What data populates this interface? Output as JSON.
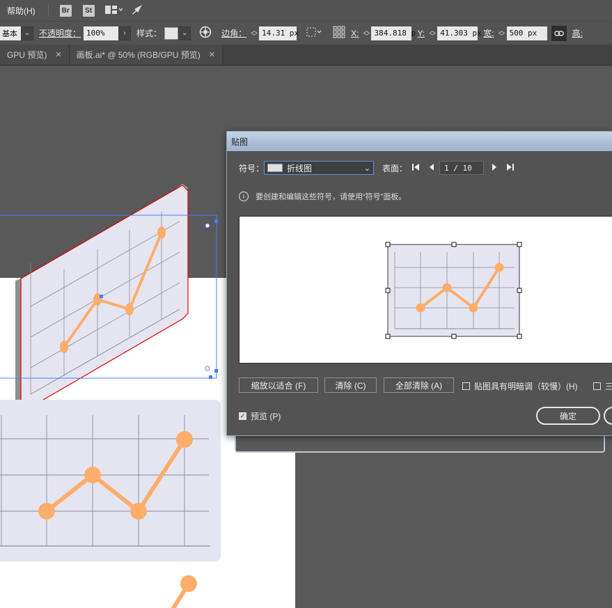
{
  "menubar": {
    "help": "帮助(H)",
    "bridge_badge": "Br",
    "stock_badge": "St"
  },
  "controlbar": {
    "stroke_profile": "基本",
    "opacity_label": "不透明度",
    "opacity_value": "100%",
    "style_label": "样式",
    "corner_label": "边角",
    "corner_value": "14.31 px",
    "x_label": "X",
    "x_value": "384.818 p",
    "y_label": "Y",
    "y_value": "41.303 px",
    "width_label": "宽",
    "width_value": "500 px",
    "height_label": "高"
  },
  "tabs": [
    {
      "label": "GPU 预览)"
    },
    {
      "label": "画板.ai* @ 50% (RGB/GPU 预览)"
    }
  ],
  "dialog": {
    "title": "贴图",
    "symbol_label": "符号：",
    "symbol_value": "折线图",
    "surface_label": "表面：",
    "page_value": "1 / 10",
    "info_text": "要创建和编辑这些符号，请使用“符号”面板。",
    "btn_fit": "缩放以适合 (F)",
    "btn_clear": "清除 (C)",
    "btn_clear_all": "全部清除 (A)",
    "shade_label": "贴图具有明暗调（较慢）(H)",
    "other_label": "三",
    "preview_label": "预览 (P)",
    "ok_label": "确定"
  },
  "colors": {
    "accent_orange": "#ffad6a",
    "panel_fill": "#e4e5f0",
    "selection_blue": "#4a7cff",
    "dialog_title": "#b3c6dc"
  }
}
